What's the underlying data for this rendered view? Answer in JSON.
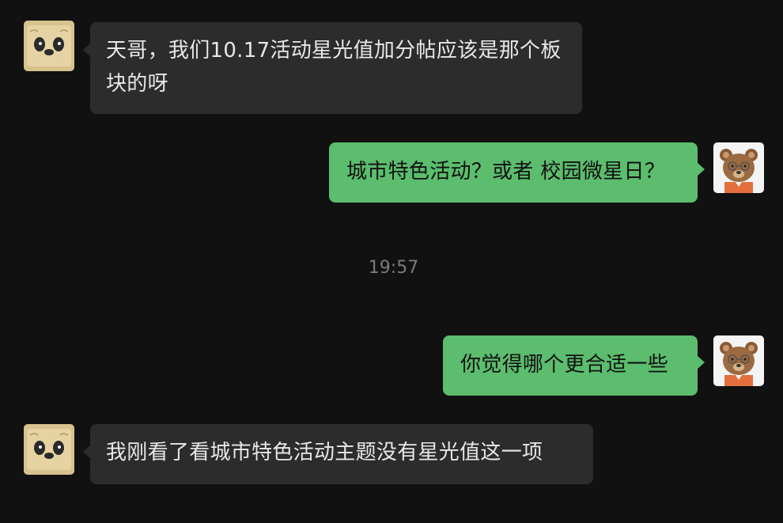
{
  "messages": [
    {
      "side": "incoming",
      "text": "天哥，我们10.17活动星光值加分帖应该是那个板块的呀",
      "avatar": "panda-avatar-icon"
    },
    {
      "side": "outgoing",
      "text": "城市特色活动？或者 校园微星日？",
      "avatar": "bear-avatar-icon"
    },
    {
      "side": "outgoing",
      "text": "你觉得哪个更合适一些",
      "avatar": "bear-avatar-icon"
    },
    {
      "side": "incoming",
      "text": "我刚看了看城市特色活动主题没有星光值这一项",
      "avatar": "panda-avatar-icon"
    }
  ],
  "timestamp": "19:57",
  "colors": {
    "background": "#111111",
    "incoming_bubble": "#2c2c2c",
    "outgoing_bubble": "#5bbd6d",
    "timestamp_text": "#7a7a7a"
  }
}
